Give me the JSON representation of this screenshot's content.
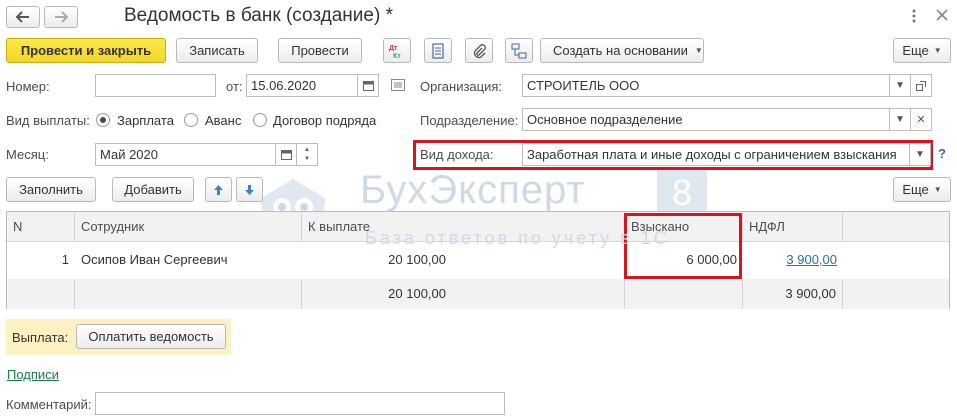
{
  "window": {
    "title": "Ведомость в банк (создание) *"
  },
  "toolbar": {
    "post_and_close": "Провести и закрыть",
    "save": "Записать",
    "post": "Провести",
    "dt_kt": "Дт Кт",
    "create_based_on": "Создать на основании",
    "more": "Еще"
  },
  "fields": {
    "number_label": "Номер:",
    "number_value": "",
    "from_label": "от:",
    "date_value": "15.06.2020",
    "org_label": "Организация:",
    "org_value": "СТРОИТЕЛЬ ООО",
    "payment_type_label": "Вид выплаты:",
    "payment_options": [
      "Зарплата",
      "Аванс",
      "Договор подряда"
    ],
    "payment_selected": "Зарплата",
    "subdivision_label": "Подразделение:",
    "subdivision_value": "Основное подразделение",
    "month_label": "Месяц:",
    "month_value": "Май 2020",
    "income_type_label": "Вид дохода:",
    "income_type_value": "Заработная плата и иные доходы с ограничением взыскания",
    "help": "?",
    "comment_label": "Комментарий:",
    "comment_value": ""
  },
  "table_toolbar": {
    "fill": "Заполнить",
    "add": "Добавить",
    "more": "Еще"
  },
  "table": {
    "columns": [
      "N",
      "Сотрудник",
      "К выплате",
      "Взыскано",
      "НДФЛ"
    ],
    "rows": [
      {
        "n": "1",
        "employee": "Осипов Иван Сергеевич",
        "to_pay": "20 100,00",
        "collected": "6 000,00",
        "ndfl": "3 900,00"
      }
    ],
    "totals": {
      "to_pay": "20 100,00",
      "ndfl": "3 900,00"
    }
  },
  "payment_panel": {
    "label": "Выплата:",
    "button": "Оплатить ведомость"
  },
  "signatures_link": "Подписи",
  "watermark": {
    "brand": "БухЭксперт",
    "number": "8",
    "tagline": "База ответов по учету в 1С"
  },
  "colors": {
    "accent_yellow": "#f3d62a",
    "highlight_red": "#d8151c",
    "link_blue": "#2f6ea4",
    "link_green": "#1a7f45"
  }
}
